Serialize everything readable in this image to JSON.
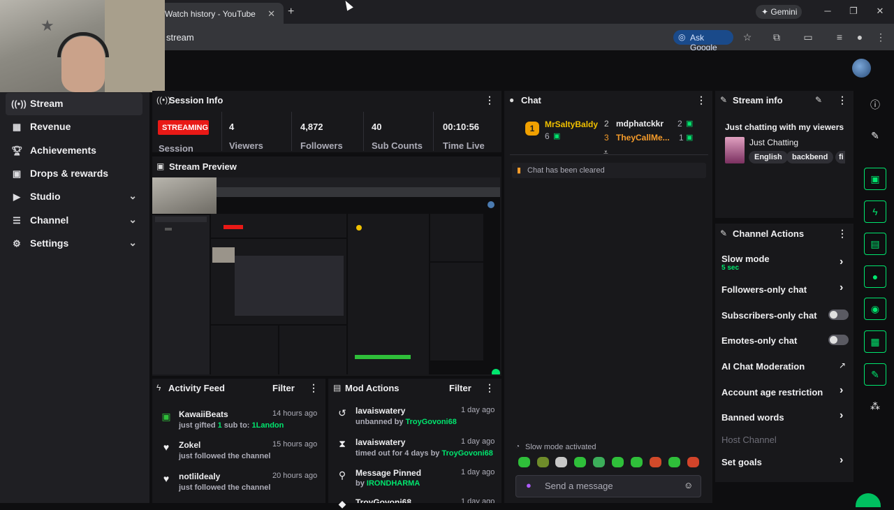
{
  "browser": {
    "tab_title": "Watch history - YouTube",
    "new_tab_icon": "plus-icon",
    "gemini_label": "Gemini",
    "address": "stream",
    "ask_google_label": "Ask Google"
  },
  "nav": {
    "items": [
      {
        "label": "Stream",
        "icon": "broadcast-icon"
      },
      {
        "label": "Revenue",
        "icon": "chart-icon"
      },
      {
        "label": "Achievements",
        "icon": "trophy-icon"
      },
      {
        "label": "Drops & rewards",
        "icon": "gift-icon"
      },
      {
        "label": "Studio",
        "icon": "film-icon"
      },
      {
        "label": "Channel",
        "icon": "list-icon"
      },
      {
        "label": "Settings",
        "icon": "gear-icon"
      }
    ]
  },
  "session": {
    "title": "Session Info",
    "status": "STREAMING",
    "status_label": "Session",
    "stats": [
      {
        "value": "4",
        "label": "Viewers"
      },
      {
        "value": "4,872",
        "label": "Followers"
      },
      {
        "value": "40",
        "label": "Sub Counts"
      },
      {
        "value": "00:10:56",
        "label": "Time Live"
      }
    ]
  },
  "preview": {
    "title": "Stream Preview"
  },
  "chat": {
    "title": "Chat",
    "leaderboard": [
      {
        "name": "MrSaltyBaldy",
        "count": "6",
        "rank": "1"
      },
      {
        "name": "mdphatckkr",
        "count": "2",
        "rank": "2"
      },
      {
        "name": "TheyCallMe...",
        "count": "1",
        "rank": "3"
      }
    ],
    "cleared_message": "Chat has been cleared",
    "slow_mode_notice": "Slow mode activated",
    "input_placeholder": "Send a message"
  },
  "stream_info": {
    "title": "Stream info",
    "stream_title": "Just chatting with my viewers",
    "category": "Just Chatting",
    "tags": [
      "English",
      "backbend",
      "fi"
    ]
  },
  "channel_actions": {
    "title": "Channel Actions",
    "slow_mode_label": "Slow mode",
    "slow_mode_value": "5 sec",
    "followers_only": "Followers-only chat",
    "subscribers_only": "Subscribers-only chat",
    "emotes_only": "Emotes-only chat",
    "ai_moderation": "AI Chat Moderation",
    "account_age": "Account age restriction",
    "banned_words": "Banned words",
    "host_channel": "Host Channel",
    "set_goals": "Set goals"
  },
  "activity": {
    "title": "Activity Feed",
    "filter": "Filter",
    "items": [
      {
        "name": "KawaiiBeats",
        "prefix": "just gifted ",
        "count": "1",
        "mid": " sub to: ",
        "target": "1Landon",
        "time": "14 hours ago",
        "icon": "gift-icon"
      },
      {
        "name": "Zokel",
        "sub": "just followed the channel",
        "time": "15 hours ago",
        "icon": "heart-icon"
      },
      {
        "name": "notlildealy",
        "sub": "just followed the channel",
        "time": "20 hours ago",
        "icon": "heart-icon"
      }
    ]
  },
  "mod_actions": {
    "title": "Mod Actions",
    "filter": "Filter",
    "items": [
      {
        "name": "lavaiswatery",
        "sub": "unbanned by ",
        "by": "TroyGovoni68",
        "time": "1 day ago",
        "icon": "undo-icon"
      },
      {
        "name": "lavaiswatery",
        "sub": "timed out for 4 days by ",
        "by": "TroyGovoni68",
        "time": "1 day ago",
        "icon": "hourglass-icon"
      },
      {
        "name": "Message Pinned",
        "sub": "by ",
        "by": "IRONDHARMA",
        "time": "1 day ago",
        "icon": "pin-icon"
      },
      {
        "name": "TroyGovoni68",
        "sub": "",
        "by": "",
        "time": "1 day ago",
        "icon": "shield-icon"
      }
    ]
  },
  "colors": {
    "accent": "#00e66e",
    "live": "#e91916",
    "panel": "#18181b",
    "page": "#0e0e10"
  }
}
